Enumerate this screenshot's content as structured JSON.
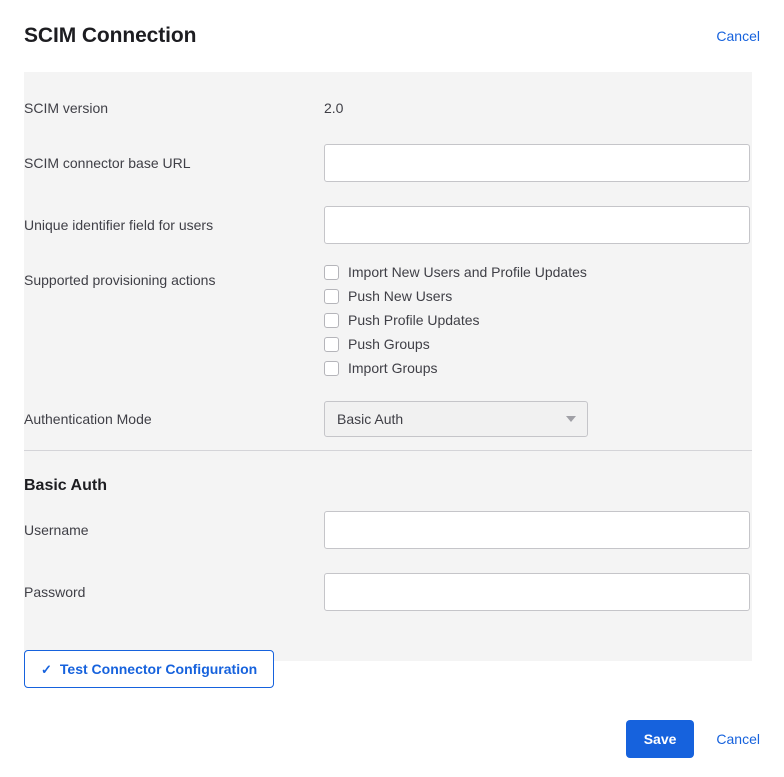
{
  "header": {
    "title": "SCIM Connection",
    "cancel_label": "Cancel"
  },
  "form": {
    "scim_version": {
      "label": "SCIM version",
      "value": "2.0"
    },
    "base_url": {
      "label": "SCIM connector base URL",
      "value": "",
      "placeholder": ""
    },
    "unique_identifier": {
      "label": "Unique identifier field for users",
      "value": "",
      "placeholder": ""
    },
    "provisioning": {
      "label": "Supported provisioning actions",
      "options": [
        {
          "label": "Import New Users and Profile Updates",
          "checked": false
        },
        {
          "label": "Push New Users",
          "checked": false
        },
        {
          "label": "Push Profile Updates",
          "checked": false
        },
        {
          "label": "Push Groups",
          "checked": false
        },
        {
          "label": "Import Groups",
          "checked": false
        }
      ]
    },
    "auth_mode": {
      "label": "Authentication Mode",
      "selected": "Basic Auth"
    }
  },
  "basic_auth_section": {
    "heading": "Basic Auth",
    "username": {
      "label": "Username",
      "value": "",
      "placeholder": ""
    },
    "password": {
      "label": "Password",
      "value": "",
      "placeholder": ""
    }
  },
  "test_button": {
    "icon": "check-icon",
    "glyph": "✓",
    "label": "Test Connector Configuration"
  },
  "footer": {
    "save_label": "Save",
    "cancel_label": "Cancel"
  },
  "colors": {
    "accent": "#1662dd",
    "panel_background": "#f4f4f4",
    "text": "#3f3f46",
    "heading": "#1d1d21",
    "border": "#c5c5c9"
  }
}
